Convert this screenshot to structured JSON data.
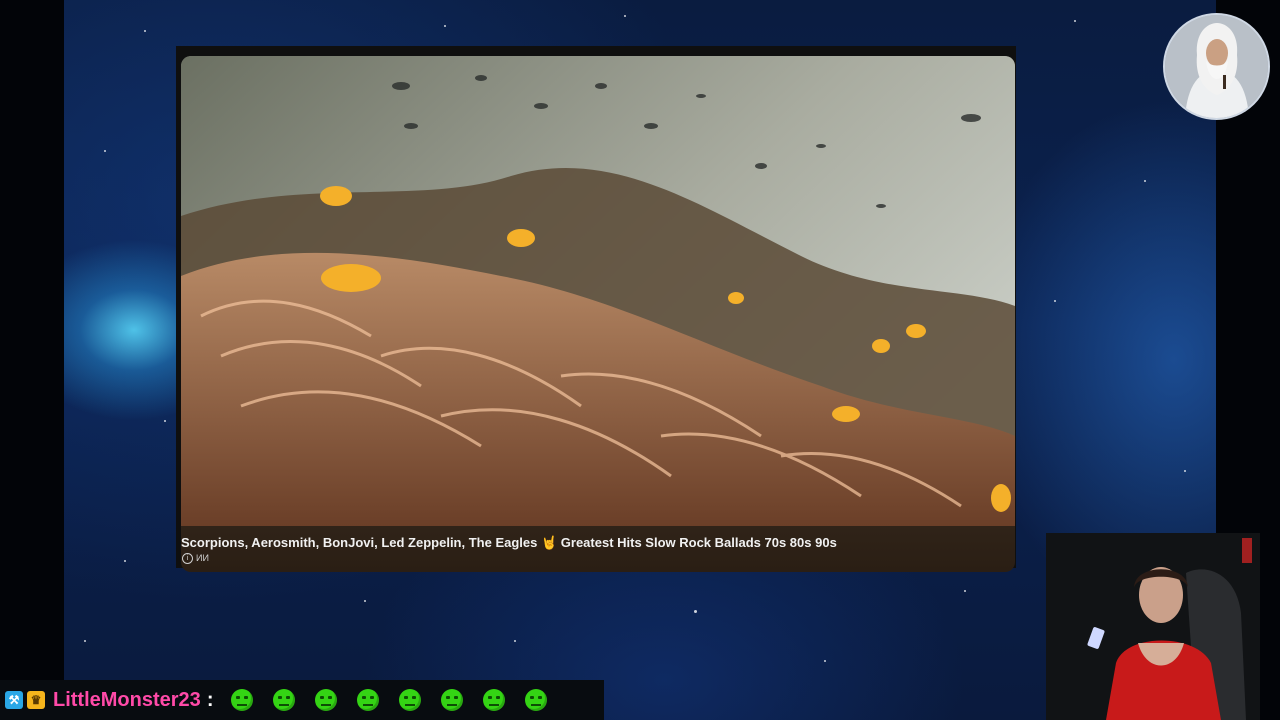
{
  "video": {
    "title": "Scorpions, Aerosmith, BonJovi, Led Zeppelin, The Eagles 🤘 Greatest Hits Slow Rock Ballads 70s 80s 90s",
    "ai_label": "ИИ",
    "info_icon": "info-icon"
  },
  "chat": {
    "badges": [
      "hammer-badge-icon",
      "crown-badge-icon"
    ],
    "username": "LittleMonster23",
    "separator": ":",
    "emote_count": 8,
    "emote_icon": "green-smiley-emote"
  },
  "colors": {
    "username": "#ff4aa8",
    "emote": "#34d414",
    "panel": "#0f0f0f"
  }
}
